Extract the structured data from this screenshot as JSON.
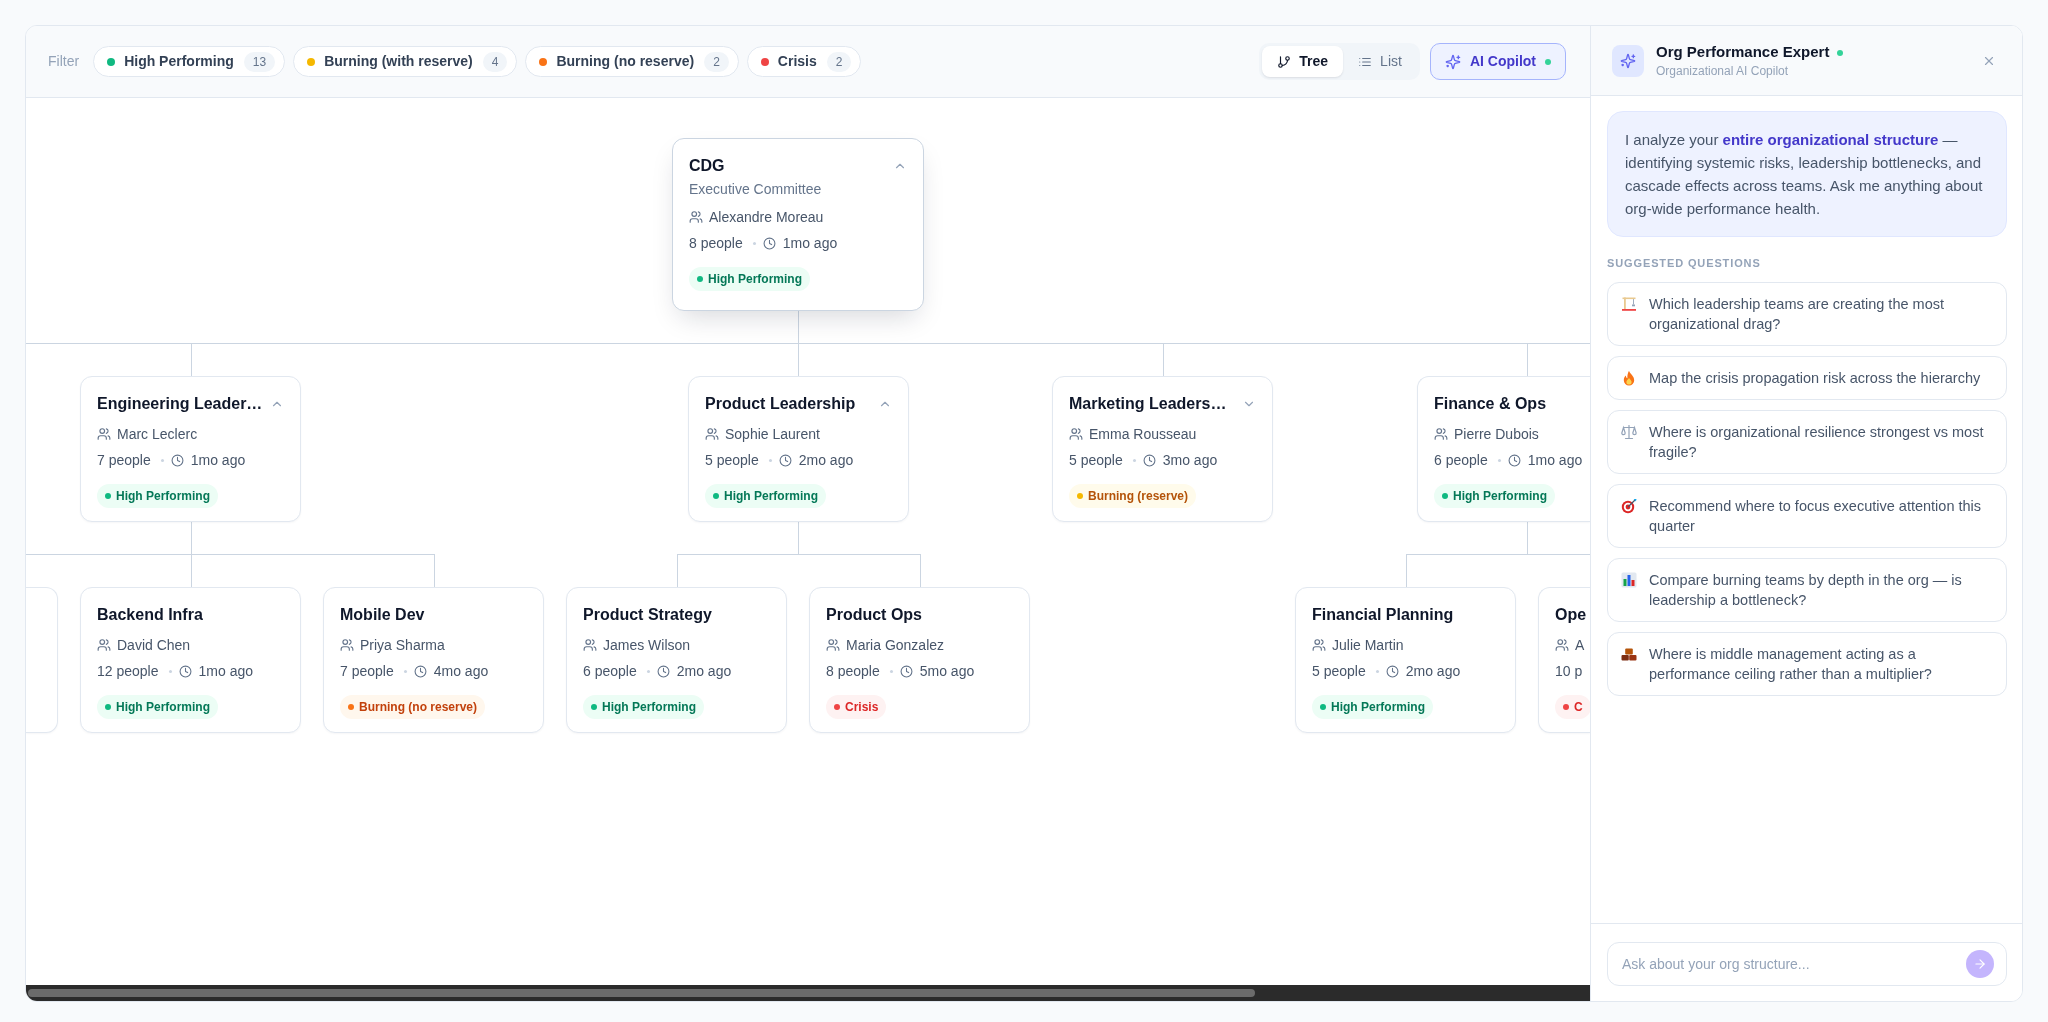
{
  "filter_bar": {
    "label": "Filter",
    "chips": [
      {
        "label": "High Performing",
        "count": "13",
        "color": "#10b981"
      },
      {
        "label": "Burning (with reserve)",
        "count": "4",
        "color": "#f5b800"
      },
      {
        "label": "Burning (no reserve)",
        "count": "2",
        "color": "#f97316"
      },
      {
        "label": "Crisis",
        "count": "2",
        "color": "#ef4444"
      }
    ]
  },
  "view_tabs": [
    {
      "kind": "tree",
      "label": "Tree",
      "selected": true
    },
    {
      "kind": "list",
      "label": "List",
      "selected": false
    }
  ],
  "copilot_button": {
    "label": "AI Copilot",
    "active": true
  },
  "org_tree": {
    "title": "CDG",
    "subtitle": "Executive Committee",
    "lead": "Alexandre Moreau",
    "people": "8 people",
    "updated": "1mo ago",
    "badge": {
      "label": "High Performing",
      "color": "#10b981"
    },
    "expanded": true,
    "children": [
      {
        "title": "Engineering Leader…",
        "lead": "Marc Leclerc",
        "people": "7 people",
        "updated": "1mo ago",
        "badge": {
          "label": "High Performing",
          "color": "#10b981"
        },
        "expanded": true,
        "more_children_left": true,
        "children": [
          {
            "title": "Backend Infra",
            "lead": "David Chen",
            "people": "12 people",
            "updated": "1mo ago",
            "badge": {
              "label": "High Performing",
              "color": "#10b981"
            }
          },
          {
            "title": "Mobile Dev",
            "lead": "Priya Sharma",
            "people": "7 people",
            "updated": "4mo ago",
            "badge": {
              "label": "Burning (no reserve)",
              "color": "#f97316"
            }
          }
        ]
      },
      {
        "title": "Product Leadership",
        "lead": "Sophie Laurent",
        "people": "5 people",
        "updated": "2mo ago",
        "badge": {
          "label": "High Performing",
          "color": "#10b981"
        },
        "expanded": true,
        "children": [
          {
            "title": "Product Strategy",
            "lead": "James Wilson",
            "people": "6 people",
            "updated": "2mo ago",
            "badge": {
              "label": "High Performing",
              "color": "#10b981"
            }
          },
          {
            "title": "Product Ops",
            "lead": "Maria Gonzalez",
            "people": "8 people",
            "updated": "5mo ago",
            "badge": {
              "label": "Crisis",
              "color": "#ef4444"
            }
          }
        ]
      },
      {
        "title": "Marketing Leaders…",
        "lead": "Emma Rousseau",
        "people": "5 people",
        "updated": "3mo ago",
        "badge": {
          "label": "Burning (reserve)",
          "color": "#f5b800"
        },
        "expanded": false
      },
      {
        "title": "Finance & Ops",
        "lead": "Pierre Dubois",
        "people": "6 people",
        "updated": "1mo ago",
        "badge": {
          "label": "High Performing",
          "color": "#10b981"
        },
        "children": [
          {
            "title": "Financial Planning",
            "lead": "Julie Martin",
            "people": "5 people",
            "updated": "2mo ago",
            "badge": {
              "label": "High Performing",
              "color": "#10b981"
            }
          },
          {
            "title": "Ope",
            "lead": "A",
            "people": "10 p",
            "badge": {
              "label": "C",
              "color": "#ef4444"
            }
          }
        ]
      }
    ]
  },
  "copilot_panel": {
    "title": "Org Performance Expert",
    "online": true,
    "subtitle": "Organizational AI Copilot",
    "intro": "I analyze your **entire organizational structure** — identifying systemic risks, leadership bottlenecks, and cascade effects across teams. Ask me anything about org-wide performance health.",
    "section_heading": "SUGGESTED QUESTIONS",
    "questions": [
      {
        "kind": "crane",
        "text": "Which leadership teams are creating the most organizational drag?"
      },
      {
        "kind": "fire",
        "text": "Map the crisis propagation risk across the hierarchy"
      },
      {
        "kind": "scales",
        "text": "Where is organizational resilience strongest vs most fragile?"
      },
      {
        "kind": "target",
        "text": "Recommend where to focus executive attention this quarter"
      },
      {
        "kind": "chart",
        "text": "Compare burning teams by depth in the org — is leadership a bottleneck?"
      },
      {
        "kind": "bricks",
        "text": "Where is middle management acting as a performance ceiling rather than a multiplier?"
      }
    ],
    "input": {
      "placeholder": "Ask about your org structure..."
    }
  }
}
